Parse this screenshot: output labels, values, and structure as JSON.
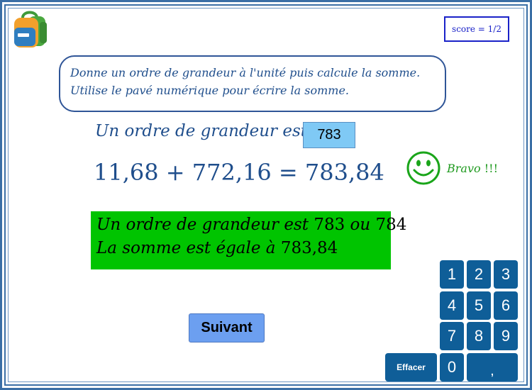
{
  "score": {
    "text": "score = 1/2"
  },
  "instructions": {
    "line1": "Donne un ordre de grandeur à l'unité puis calcule la somme.",
    "line2": "Utilise le pavé numérique pour écrire la somme."
  },
  "estimate": {
    "label": "Un ordre de grandeur est",
    "value": "783"
  },
  "equation": {
    "a": "11,68",
    "op": "+",
    "b": "772,16",
    "eq": "=",
    "result": "783,84"
  },
  "feedback": {
    "bravo": "Bravo",
    "exclaim": "!!!"
  },
  "answer": {
    "line1_prefix": "Un ordre de grandeur est",
    "line1_value1": "783",
    "line1_or": "ou",
    "line1_value2": "784",
    "line2_prefix": "La somme est égale à",
    "line2_value": "783,84"
  },
  "next_button": {
    "label": "Suivant"
  },
  "keypad": {
    "k1": "1",
    "k2": "2",
    "k3": "3",
    "k4": "4",
    "k5": "5",
    "k6": "6",
    "k7": "7",
    "k8": "8",
    "k9": "9",
    "k0": "0",
    "comma": ",",
    "clear": "Effacer"
  },
  "colors": {
    "frame": "#3a6ea5",
    "text_blue": "#1f4e8c",
    "answer_green": "#00c400",
    "key_blue": "#0f5e98",
    "estimate_box": "#7fc9f5",
    "next_button": "#6c9ff0"
  }
}
